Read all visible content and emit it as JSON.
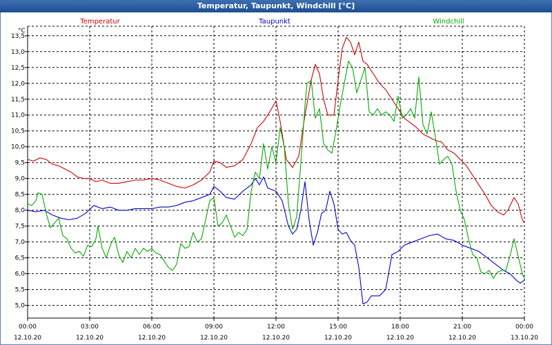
{
  "title": "Temperatur, Taupunkt, Windchill [°C]",
  "colors": {
    "title_bg": "#1c4f93",
    "grid": "#000000",
    "temperatur": "#cc0000",
    "taupunkt": "#0000cc",
    "windchill": "#00aa00"
  },
  "chart_data": {
    "type": "line",
    "title": "Temperatur, Taupunkt, Windchill [°C]",
    "ylabel": "°C",
    "ylim": [
      4.6,
      13.8
    ],
    "xlim": [
      0,
      24
    ],
    "grid": true,
    "legend_position": "top",
    "y_ticks": [
      "5,0",
      "5,5",
      "6,0",
      "6,5",
      "7,0",
      "7,5",
      "8,0",
      "8,5",
      "9,0",
      "9,5",
      "10,0",
      "10,5",
      "11,0",
      "11,5",
      "12,0",
      "12,5",
      "13,0",
      "13,5"
    ],
    "x_ticks": [
      {
        "time": "00:00",
        "date": "12.10.20"
      },
      {
        "time": "03:00",
        "date": "12.10.20"
      },
      {
        "time": "06:00",
        "date": "12.10.20"
      },
      {
        "time": "09:00",
        "date": "12.10.20"
      },
      {
        "time": "12:00",
        "date": "12.10.20"
      },
      {
        "time": "15:00",
        "date": "12.10.20"
      },
      {
        "time": "18:00",
        "date": "12.10.20"
      },
      {
        "time": "21:00",
        "date": "12.10.20"
      },
      {
        "time": "00:00",
        "date": "13.10.20"
      }
    ],
    "series": [
      {
        "name": "Temperatur",
        "color": "#cc0000",
        "points": [
          [
            0,
            9.6
          ],
          [
            0.3,
            9.55
          ],
          [
            0.6,
            9.65
          ],
          [
            0.9,
            9.6
          ],
          [
            1.2,
            9.45
          ],
          [
            1.5,
            9.4
          ],
          [
            1.8,
            9.3
          ],
          [
            2.1,
            9.2
          ],
          [
            2.4,
            9.05
          ],
          [
            2.7,
            9.0
          ],
          [
            3.0,
            9.0
          ],
          [
            3.3,
            8.9
          ],
          [
            3.6,
            8.95
          ],
          [
            4.0,
            8.85
          ],
          [
            4.4,
            8.85
          ],
          [
            4.8,
            8.9
          ],
          [
            5.2,
            8.95
          ],
          [
            5.6,
            8.95
          ],
          [
            6.0,
            9.0
          ],
          [
            6.4,
            8.95
          ],
          [
            6.8,
            8.85
          ],
          [
            7.2,
            8.75
          ],
          [
            7.6,
            8.7
          ],
          [
            8.0,
            8.8
          ],
          [
            8.4,
            8.95
          ],
          [
            8.8,
            9.2
          ],
          [
            9.0,
            9.55
          ],
          [
            9.3,
            9.5
          ],
          [
            9.6,
            9.35
          ],
          [
            10.0,
            9.4
          ],
          [
            10.4,
            9.6
          ],
          [
            10.8,
            10.1
          ],
          [
            11.1,
            10.6
          ],
          [
            11.4,
            10.8
          ],
          [
            11.7,
            11.1
          ],
          [
            12.0,
            11.45
          ],
          [
            12.2,
            10.8
          ],
          [
            12.5,
            9.6
          ],
          [
            12.8,
            9.35
          ],
          [
            13.1,
            9.7
          ],
          [
            13.4,
            11.0
          ],
          [
            13.7,
            12.1
          ],
          [
            13.9,
            12.6
          ],
          [
            14.1,
            12.3
          ],
          [
            14.3,
            11.5
          ],
          [
            14.5,
            11.0
          ],
          [
            14.8,
            11.0
          ],
          [
            15.0,
            12.1
          ],
          [
            15.2,
            13.1
          ],
          [
            15.4,
            13.45
          ],
          [
            15.6,
            13.3
          ],
          [
            15.8,
            12.9
          ],
          [
            16.0,
            13.3
          ],
          [
            16.2,
            12.7
          ],
          [
            16.4,
            12.6
          ],
          [
            16.7,
            12.3
          ],
          [
            17.0,
            12.0
          ],
          [
            17.3,
            11.8
          ],
          [
            17.6,
            11.5
          ],
          [
            17.9,
            11.2
          ],
          [
            18.2,
            10.9
          ],
          [
            18.5,
            10.75
          ],
          [
            18.8,
            10.6
          ],
          [
            19.1,
            10.4
          ],
          [
            19.4,
            10.3
          ],
          [
            19.7,
            10.2
          ],
          [
            20.0,
            10.15
          ],
          [
            20.3,
            9.9
          ],
          [
            20.6,
            9.8
          ],
          [
            20.9,
            9.6
          ],
          [
            21.2,
            9.4
          ],
          [
            21.5,
            9.1
          ],
          [
            21.8,
            8.8
          ],
          [
            22.1,
            8.5
          ],
          [
            22.4,
            8.15
          ],
          [
            22.7,
            7.95
          ],
          [
            23.0,
            7.85
          ],
          [
            23.2,
            8.0
          ],
          [
            23.5,
            8.4
          ],
          [
            23.7,
            8.2
          ],
          [
            23.9,
            7.7
          ],
          [
            24.0,
            7.6
          ]
        ]
      },
      {
        "name": "Taupunkt",
        "color": "#0000cc",
        "points": [
          [
            0,
            8.0
          ],
          [
            0.4,
            7.95
          ],
          [
            0.8,
            8.0
          ],
          [
            1.2,
            7.85
          ],
          [
            1.6,
            7.75
          ],
          [
            2.0,
            7.7
          ],
          [
            2.4,
            7.75
          ],
          [
            2.8,
            7.9
          ],
          [
            3.2,
            8.15
          ],
          [
            3.6,
            8.05
          ],
          [
            4.0,
            8.1
          ],
          [
            4.4,
            8.0
          ],
          [
            4.8,
            8.0
          ],
          [
            5.2,
            8.05
          ],
          [
            5.6,
            8.05
          ],
          [
            6.0,
            8.05
          ],
          [
            6.4,
            8.1
          ],
          [
            6.8,
            8.1
          ],
          [
            7.2,
            8.15
          ],
          [
            7.6,
            8.25
          ],
          [
            8.0,
            8.3
          ],
          [
            8.4,
            8.4
          ],
          [
            8.8,
            8.5
          ],
          [
            9.0,
            8.75
          ],
          [
            9.3,
            8.6
          ],
          [
            9.6,
            8.4
          ],
          [
            10.0,
            8.35
          ],
          [
            10.4,
            8.6
          ],
          [
            10.8,
            8.8
          ],
          [
            11.0,
            9.0
          ],
          [
            11.2,
            8.8
          ],
          [
            11.4,
            9.05
          ],
          [
            11.6,
            8.7
          ],
          [
            12.0,
            8.6
          ],
          [
            12.3,
            8.3
          ],
          [
            12.6,
            7.5
          ],
          [
            12.8,
            7.25
          ],
          [
            13.0,
            7.4
          ],
          [
            13.2,
            8.0
          ],
          [
            13.4,
            8.9
          ],
          [
            13.6,
            7.7
          ],
          [
            13.8,
            6.9
          ],
          [
            14.0,
            7.3
          ],
          [
            14.2,
            7.9
          ],
          [
            14.4,
            8.0
          ],
          [
            14.6,
            8.6
          ],
          [
            14.8,
            8.2
          ],
          [
            15.0,
            7.4
          ],
          [
            15.2,
            7.25
          ],
          [
            15.4,
            7.3
          ],
          [
            15.6,
            7.05
          ],
          [
            15.8,
            6.9
          ],
          [
            16.0,
            6.2
          ],
          [
            16.2,
            5.05
          ],
          [
            16.4,
            5.1
          ],
          [
            16.6,
            5.3
          ],
          [
            17.0,
            5.3
          ],
          [
            17.3,
            5.5
          ],
          [
            17.6,
            6.6
          ],
          [
            17.9,
            6.7
          ],
          [
            18.2,
            6.9
          ],
          [
            18.6,
            7.0
          ],
          [
            19.0,
            7.1
          ],
          [
            19.4,
            7.2
          ],
          [
            19.8,
            7.25
          ],
          [
            20.2,
            7.1
          ],
          [
            20.6,
            7.05
          ],
          [
            21.0,
            6.9
          ],
          [
            21.4,
            6.8
          ],
          [
            21.8,
            6.7
          ],
          [
            22.2,
            6.5
          ],
          [
            22.6,
            6.3
          ],
          [
            23.0,
            6.1
          ],
          [
            23.3,
            6.0
          ],
          [
            23.6,
            5.8
          ],
          [
            23.8,
            5.7
          ],
          [
            24.0,
            5.8
          ]
        ]
      },
      {
        "name": "Windchill",
        "color": "#00aa00",
        "points": [
          [
            0,
            8.2
          ],
          [
            0.2,
            8.15
          ],
          [
            0.4,
            8.3
          ],
          [
            0.5,
            8.55
          ],
          [
            0.7,
            8.5
          ],
          [
            0.9,
            7.9
          ],
          [
            1.1,
            7.45
          ],
          [
            1.3,
            7.6
          ],
          [
            1.5,
            7.75
          ],
          [
            1.7,
            7.2
          ],
          [
            1.9,
            7.1
          ],
          [
            2.1,
            6.8
          ],
          [
            2.3,
            6.65
          ],
          [
            2.5,
            6.7
          ],
          [
            2.7,
            6.55
          ],
          [
            2.9,
            6.9
          ],
          [
            3.1,
            6.85
          ],
          [
            3.3,
            7.1
          ],
          [
            3.4,
            7.5
          ],
          [
            3.6,
            6.8
          ],
          [
            3.8,
            6.5
          ],
          [
            4.0,
            6.9
          ],
          [
            4.2,
            7.15
          ],
          [
            4.4,
            6.6
          ],
          [
            4.6,
            6.35
          ],
          [
            4.8,
            6.7
          ],
          [
            5.0,
            6.5
          ],
          [
            5.2,
            6.8
          ],
          [
            5.4,
            6.6
          ],
          [
            5.6,
            6.8
          ],
          [
            5.8,
            6.7
          ],
          [
            6.0,
            6.8
          ],
          [
            6.2,
            6.65
          ],
          [
            6.4,
            6.6
          ],
          [
            6.6,
            6.4
          ],
          [
            6.8,
            6.2
          ],
          [
            7.0,
            6.1
          ],
          [
            7.2,
            6.3
          ],
          [
            7.4,
            6.95
          ],
          [
            7.6,
            6.8
          ],
          [
            7.8,
            6.85
          ],
          [
            8.0,
            7.3
          ],
          [
            8.2,
            7.0
          ],
          [
            8.4,
            7.1
          ],
          [
            8.6,
            7.7
          ],
          [
            8.8,
            8.3
          ],
          [
            9.0,
            8.4
          ],
          [
            9.2,
            7.5
          ],
          [
            9.4,
            7.6
          ],
          [
            9.6,
            7.85
          ],
          [
            9.8,
            7.5
          ],
          [
            10.0,
            7.15
          ],
          [
            10.2,
            7.3
          ],
          [
            10.4,
            7.2
          ],
          [
            10.6,
            7.4
          ],
          [
            10.8,
            8.6
          ],
          [
            11.0,
            9.2
          ],
          [
            11.2,
            9.0
          ],
          [
            11.4,
            10.1
          ],
          [
            11.6,
            9.3
          ],
          [
            11.8,
            10.0
          ],
          [
            12.0,
            9.5
          ],
          [
            12.2,
            10.6
          ],
          [
            12.4,
            10.0
          ],
          [
            12.6,
            8.2
          ],
          [
            12.8,
            7.4
          ],
          [
            13.0,
            7.8
          ],
          [
            13.2,
            9.5
          ],
          [
            13.4,
            11.3
          ],
          [
            13.5,
            12.0
          ],
          [
            13.7,
            12.1
          ],
          [
            13.9,
            10.9
          ],
          [
            14.1,
            11.2
          ],
          [
            14.3,
            10.1
          ],
          [
            14.5,
            9.9
          ],
          [
            14.7,
            9.8
          ],
          [
            14.9,
            10.5
          ],
          [
            15.1,
            11.3
          ],
          [
            15.3,
            12.0
          ],
          [
            15.5,
            12.7
          ],
          [
            15.7,
            12.5
          ],
          [
            15.9,
            11.7
          ],
          [
            16.1,
            12.1
          ],
          [
            16.3,
            12.5
          ],
          [
            16.5,
            11.1
          ],
          [
            16.7,
            11.0
          ],
          [
            16.9,
            11.2
          ],
          [
            17.1,
            11.0
          ],
          [
            17.3,
            11.1
          ],
          [
            17.5,
            11.0
          ],
          [
            17.7,
            10.8
          ],
          [
            17.9,
            11.6
          ],
          [
            18.1,
            10.9
          ],
          [
            18.3,
            11.0
          ],
          [
            18.5,
            11.2
          ],
          [
            18.7,
            10.9
          ],
          [
            18.9,
            12.2
          ],
          [
            19.1,
            10.7
          ],
          [
            19.3,
            10.4
          ],
          [
            19.5,
            11.1
          ],
          [
            19.7,
            10.3
          ],
          [
            19.9,
            9.45
          ],
          [
            20.1,
            9.6
          ],
          [
            20.3,
            9.7
          ],
          [
            20.5,
            9.45
          ],
          [
            20.7,
            8.6
          ],
          [
            20.9,
            8.0
          ],
          [
            21.1,
            7.7
          ],
          [
            21.3,
            7.1
          ],
          [
            21.5,
            6.6
          ],
          [
            21.7,
            6.5
          ],
          [
            21.9,
            6.05
          ],
          [
            22.1,
            6.0
          ],
          [
            22.3,
            6.1
          ],
          [
            22.5,
            5.85
          ],
          [
            22.7,
            6.05
          ],
          [
            22.9,
            6.1
          ],
          [
            23.1,
            6.1
          ],
          [
            23.3,
            6.55
          ],
          [
            23.5,
            7.1
          ],
          [
            23.7,
            6.55
          ],
          [
            23.9,
            6.0
          ],
          [
            24.0,
            5.85
          ]
        ]
      }
    ]
  }
}
